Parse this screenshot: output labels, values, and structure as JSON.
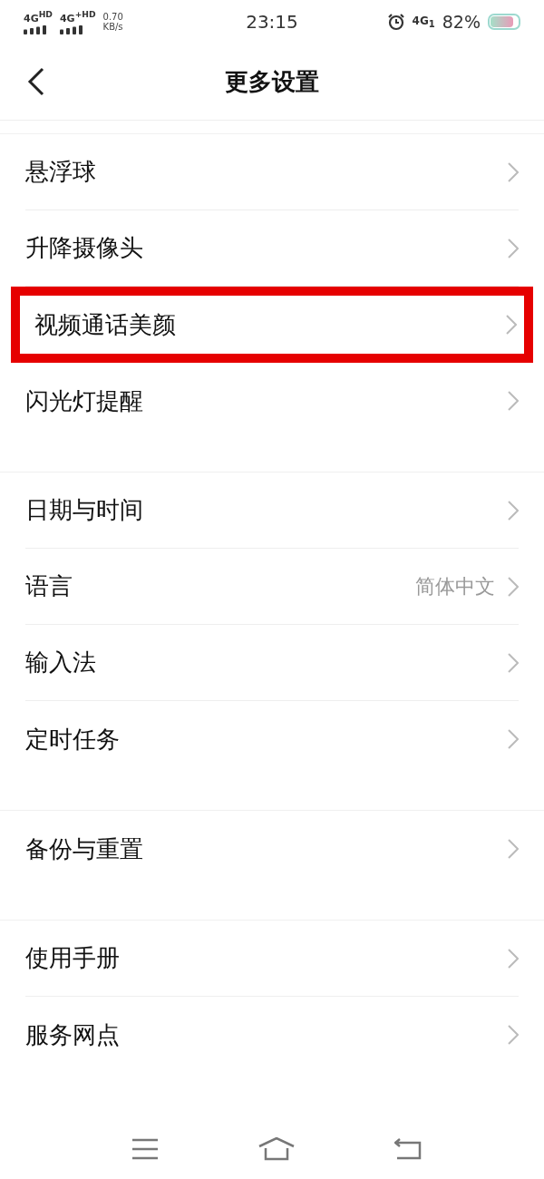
{
  "status_bar": {
    "network_1": "4G$^{HD}$",
    "network_2": "4G$^{+HD}$",
    "speed": "0.70",
    "speed_unit": "KB/s",
    "time": "23:15",
    "network_3": "4G$_{1}$",
    "battery_text": "82%",
    "battery": {
      "level": 0.82
    }
  },
  "header": {
    "title": "更多设置"
  },
  "sections": [
    {
      "items": [
        {
          "label": "悬浮球",
          "highlighted": false
        },
        {
          "label": "升降摄像头",
          "highlighted": false
        },
        {
          "label": "视频通话美颜",
          "highlighted": true
        },
        {
          "label": "闪光灯提醒",
          "highlighted": false
        }
      ]
    },
    {
      "items": [
        {
          "label": "日期与时间",
          "highlighted": false
        },
        {
          "label": "语言",
          "value": "简体中文",
          "highlighted": false
        },
        {
          "label": "输入法",
          "highlighted": false
        },
        {
          "label": "定时任务",
          "highlighted": false
        }
      ]
    },
    {
      "items": [
        {
          "label": "备份与重置",
          "highlighted": false
        }
      ]
    },
    {
      "items": [
        {
          "label": "使用手册",
          "highlighted": false
        },
        {
          "label": "服务网点",
          "highlighted": false
        }
      ]
    }
  ]
}
